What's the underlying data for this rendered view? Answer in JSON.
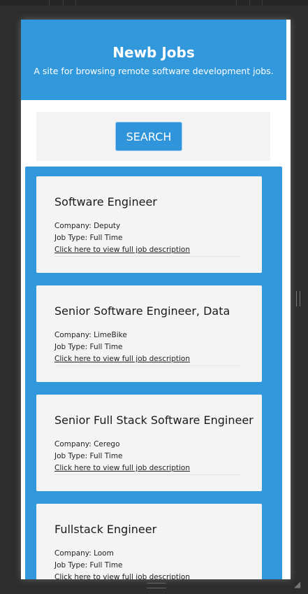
{
  "header": {
    "title": "Newb Jobs",
    "subtitle": "A site for browsing remote software development jobs."
  },
  "search": {
    "button_label": "SEARCH"
  },
  "jobs": [
    {
      "title": "Software Engineer",
      "company": "Company: Deputy",
      "job_type": "Job Type: Full Time",
      "link": "Click here to view full job description"
    },
    {
      "title": "Senior Software Engineer, Data",
      "company": "Company: LimeBike",
      "job_type": "Job Type: Full Time",
      "link": "Click here to view full job description"
    },
    {
      "title": "Senior Full Stack Software Engineer",
      "company": "Company: Cerego",
      "job_type": "Job Type: Full Time",
      "link": "Click here to view full job description"
    },
    {
      "title": "Fullstack Engineer",
      "company": "Company: Loom",
      "job_type": "Job Type: Full Time",
      "link": "Click here to view full job description"
    }
  ],
  "colors": {
    "brand_blue": "#3198dc",
    "card_bg": "#f4f4f4"
  }
}
